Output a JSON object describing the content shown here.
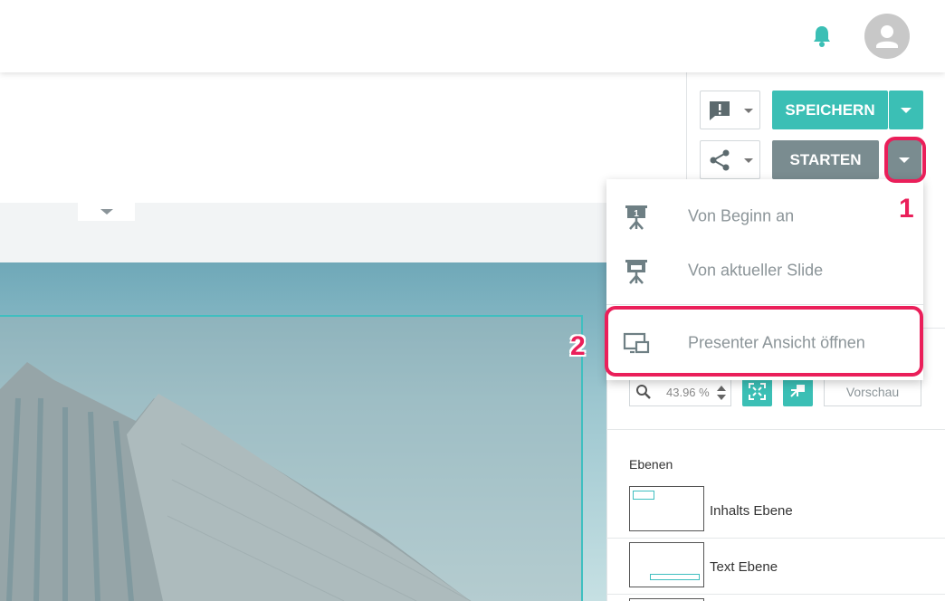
{
  "header": {
    "notification_icon": "bell-icon",
    "avatar_icon": "user-avatar-icon"
  },
  "toolbar": {
    "feedback_icon": "feedback-icon",
    "share_icon": "share-icon",
    "save_label": "SPEICHERN",
    "start_label": "STARTEN"
  },
  "start_menu": {
    "items": [
      {
        "label": "Von Beginn an",
        "icon": "presentation-first-slide-icon"
      },
      {
        "label": "Von aktueller Slide",
        "icon": "presentation-current-slide-icon"
      },
      {
        "label": "Presenter Ansicht öffnen",
        "icon": "presenter-view-icon"
      }
    ]
  },
  "zoom": {
    "value": "43.96 %",
    "search_icon": "search-icon"
  },
  "preview_label": "Vorschau",
  "layers": {
    "title": "Ebenen",
    "items": [
      {
        "name": "Inhalts Ebene"
      },
      {
        "name": "Text Ebene"
      }
    ]
  },
  "annotations": {
    "one": "1",
    "two": "2"
  },
  "colors": {
    "accent_teal": "#3bbfb5",
    "start_gray": "#7a8c90",
    "annotation_pink": "#ea1f5a"
  }
}
